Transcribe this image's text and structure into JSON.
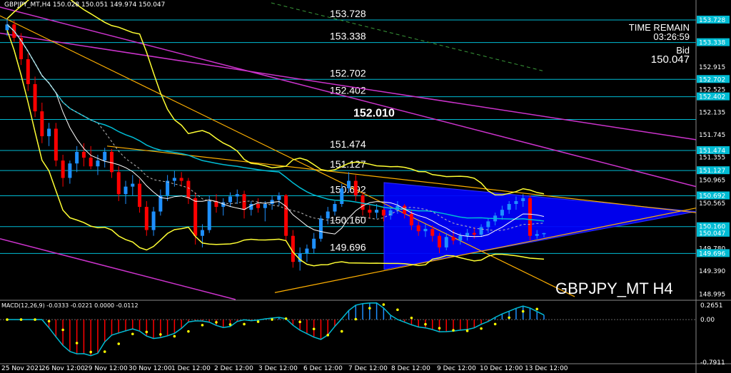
{
  "header": {
    "text": "GBPJPY_MT,H4  150.028 150.051 149.974 150.047"
  },
  "info": {
    "time_remain_label": "TIME REMAIN",
    "time_remain": "03:26:59",
    "bid_label": "Bid",
    "bid": "150.047"
  },
  "symbol_label": "GBPJPY_MT H4",
  "macd_header": "MACD(12,26,9) -0.0333 -0.0221 0.0000 -0.0112",
  "colors": {
    "bull": "#1e90ff",
    "bear": "#ff0000",
    "hline": "#00bcd4",
    "triangle": "#0000ff",
    "bands": "#ffff33",
    "trend_magenta": "#cc33cc",
    "trend_gold": "#ffb000"
  },
  "chart_data": {
    "type": "candlestick",
    "ylim": [
      148.9,
      153.9
    ],
    "y_ticks": [
      "153.728",
      "153.338",
      "152.915",
      "152.702",
      "152.525",
      "152.402",
      "152.135",
      "151.745",
      "151.474",
      "151.355",
      "151.127",
      "150.965",
      "150.692",
      "150.565",
      "150.160",
      "150.047",
      "149.780",
      "149.696",
      "149.390",
      "148.995"
    ],
    "y_tick_values": [
      153.728,
      153.338,
      152.915,
      152.702,
      152.525,
      152.402,
      152.135,
      151.745,
      151.474,
      151.355,
      151.127,
      150.965,
      150.692,
      150.565,
      150.16,
      150.047,
      149.78,
      149.696,
      149.39,
      148.995
    ],
    "highlight_ticks": [
      153.728,
      153.338,
      152.702,
      152.402,
      151.474,
      151.127,
      150.692,
      150.16,
      150.047,
      149.696
    ],
    "x_labels": [
      "25 Nov 2021",
      "26 Nov 12:00",
      "29 Nov 12:00",
      "30 Nov 12:00",
      "1 Dec 12:00",
      "2 Dec 12:00",
      "3 Dec 12:00",
      "6 Dec 12:00",
      "7 Dec 12:00",
      "8 Dec 12:00",
      "9 Dec 12:00",
      "10 Dec 12:00",
      "13 Dec 12:00"
    ],
    "horizontal_levels": [
      {
        "value": 153.728,
        "label": "153.728"
      },
      {
        "value": 153.338,
        "label": "153.338"
      },
      {
        "value": 152.702,
        "label": "152.702"
      },
      {
        "value": 152.402,
        "label": "152.402"
      },
      {
        "value": 152.01,
        "label": "152.010"
      },
      {
        "value": 151.474,
        "label": "151.474"
      },
      {
        "value": 151.127,
        "label": "151.127"
      },
      {
        "value": 150.692,
        "label": "150.692"
      },
      {
        "value": 150.16,
        "label": "150.160"
      },
      {
        "value": 149.696,
        "label": "149.696"
      }
    ],
    "candles": [
      [
        153.55,
        153.75,
        153.45,
        153.65
      ],
      [
        153.65,
        153.72,
        153.35,
        153.42
      ],
      [
        153.42,
        153.5,
        152.95,
        153.05
      ],
      [
        153.05,
        153.15,
        152.5,
        152.62
      ],
      [
        152.62,
        152.75,
        152.05,
        152.15
      ],
      [
        152.15,
        152.3,
        151.6,
        151.72
      ],
      [
        151.72,
        151.95,
        151.55,
        151.85
      ],
      [
        151.85,
        151.95,
        151.2,
        151.3
      ],
      [
        151.3,
        151.4,
        150.85,
        151.0
      ],
      [
        151.0,
        151.3,
        150.9,
        151.25
      ],
      [
        151.25,
        151.55,
        151.1,
        151.45
      ],
      [
        151.45,
        151.6,
        151.2,
        151.35
      ],
      [
        151.35,
        151.55,
        151.15,
        151.2
      ],
      [
        151.2,
        151.4,
        151.05,
        151.3
      ],
      [
        151.3,
        151.52,
        151.18,
        151.45
      ],
      [
        151.45,
        151.5,
        151.0,
        151.1
      ],
      [
        151.1,
        151.2,
        150.6,
        150.72
      ],
      [
        150.72,
        150.95,
        150.55,
        150.85
      ],
      [
        150.85,
        151.05,
        150.7,
        150.9
      ],
      [
        150.9,
        150.98,
        150.4,
        150.5
      ],
      [
        150.5,
        150.6,
        150.0,
        150.1
      ],
      [
        150.1,
        150.5,
        150.0,
        150.42
      ],
      [
        150.42,
        150.8,
        150.35,
        150.7
      ],
      [
        150.7,
        151.05,
        150.6,
        150.95
      ],
      [
        150.95,
        151.12,
        150.85,
        151.0
      ],
      [
        151.0,
        151.1,
        150.85,
        150.95
      ],
      [
        150.95,
        151.0,
        150.55,
        150.65
      ],
      [
        150.65,
        150.75,
        149.85,
        150.0
      ],
      [
        150.0,
        150.2,
        149.8,
        150.1
      ],
      [
        150.1,
        150.7,
        150.05,
        150.6
      ],
      [
        150.6,
        150.72,
        150.4,
        150.5
      ],
      [
        150.5,
        150.65,
        150.35,
        150.58
      ],
      [
        150.58,
        150.75,
        150.5,
        150.68
      ],
      [
        150.68,
        150.8,
        150.55,
        150.72
      ],
      [
        150.72,
        150.78,
        150.3,
        150.45
      ],
      [
        150.45,
        150.6,
        150.35,
        150.55
      ],
      [
        150.55,
        150.65,
        150.4,
        150.48
      ],
      [
        150.48,
        150.6,
        150.25,
        150.55
      ],
      [
        150.55,
        150.7,
        150.45,
        150.62
      ],
      [
        150.62,
        150.75,
        150.52,
        150.7
      ],
      [
        150.7,
        150.72,
        149.9,
        150.0
      ],
      [
        150.0,
        150.1,
        149.45,
        149.55
      ],
      [
        149.55,
        149.8,
        149.4,
        149.7
      ],
      [
        149.7,
        149.85,
        149.55,
        149.78
      ],
      [
        149.78,
        150.05,
        149.7,
        149.95
      ],
      [
        149.95,
        150.35,
        149.9,
        150.3
      ],
      [
        150.3,
        150.5,
        150.2,
        150.42
      ],
      [
        150.42,
        150.6,
        150.35,
        150.55
      ],
      [
        150.55,
        150.9,
        150.5,
        150.82
      ],
      [
        150.82,
        151.1,
        150.75,
        150.95
      ],
      [
        150.95,
        151.05,
        150.6,
        150.7
      ],
      [
        150.7,
        150.75,
        150.35,
        150.45
      ],
      [
        150.45,
        150.55,
        150.3,
        150.4
      ],
      [
        150.4,
        150.55,
        150.3,
        150.45
      ],
      [
        150.45,
        150.5,
        150.25,
        150.35
      ],
      [
        150.35,
        150.5,
        150.28,
        150.44
      ],
      [
        150.44,
        150.6,
        150.38,
        150.52
      ],
      [
        150.52,
        150.55,
        150.3,
        150.38
      ],
      [
        150.38,
        150.45,
        150.1,
        150.18
      ],
      [
        150.18,
        150.25,
        150.0,
        150.08
      ],
      [
        150.08,
        150.2,
        149.98,
        150.12
      ],
      [
        150.12,
        150.18,
        149.9,
        150.0
      ],
      [
        150.0,
        150.05,
        149.7,
        149.8
      ],
      [
        149.8,
        150.05,
        149.75,
        149.98
      ],
      [
        149.98,
        150.1,
        149.85,
        149.92
      ],
      [
        149.92,
        150.05,
        149.85,
        150.0
      ],
      [
        150.0,
        150.12,
        149.92,
        150.05
      ],
      [
        150.05,
        150.15,
        149.95,
        150.02
      ],
      [
        150.02,
        150.2,
        149.98,
        150.15
      ],
      [
        150.15,
        150.3,
        150.05,
        150.25
      ],
      [
        150.25,
        150.4,
        150.18,
        150.35
      ],
      [
        150.35,
        150.52,
        150.28,
        150.45
      ],
      [
        150.45,
        150.6,
        150.38,
        150.55
      ],
      [
        150.55,
        150.68,
        150.45,
        150.6
      ],
      [
        150.6,
        150.72,
        150.5,
        150.65
      ],
      [
        150.65,
        150.7,
        149.92,
        150.0
      ],
      [
        150.0,
        150.1,
        149.95,
        150.03
      ],
      [
        150.028,
        150.051,
        149.974,
        150.047
      ]
    ],
    "macd_ylim": [
      -0.7911,
      0.2651
    ],
    "macd_ticks": [
      "0.2651",
      "0.00",
      "-0.7911"
    ],
    "macd_tick_values": [
      0.2651,
      0.0,
      -0.7911
    ]
  }
}
